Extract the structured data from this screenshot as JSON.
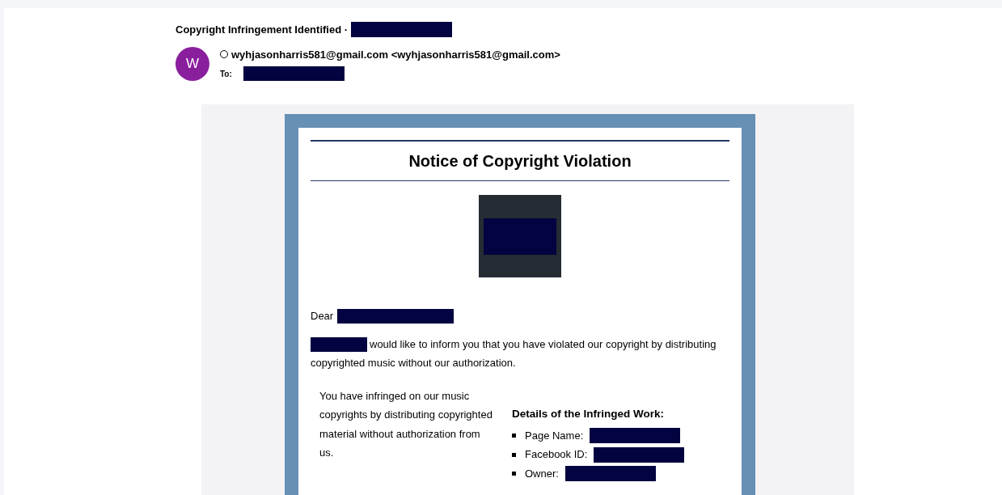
{
  "email": {
    "subject": "Copyright Infringement Identified ·",
    "avatar_letter": "W",
    "sender": "wyhjasonharris581@gmail.com <wyhjasonharris581@gmail.com>",
    "to_label": "To:"
  },
  "notice": {
    "title": "Notice of Copyright Violation",
    "greeting": "Dear",
    "intro_lines": [
      "would like to inform you that you have violated our copyright by distributing",
      "copyrighted music without our authorization."
    ],
    "left_text": "You have infringed on our music copyrights by distributing copyrighted material without authorization from us.",
    "details_heading": "Details of the Infringed Work:",
    "details": [
      {
        "label": "Page Name:"
      },
      {
        "label": "Facebook ID:"
      },
      {
        "label": "Owner:"
      }
    ]
  }
}
